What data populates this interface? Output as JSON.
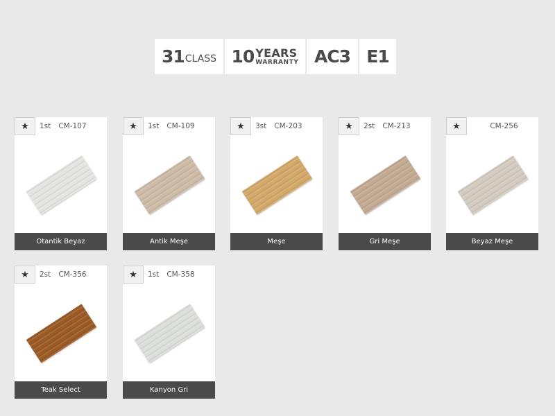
{
  "badges": [
    {
      "big": "31",
      "small": "CLASS"
    },
    {
      "big": "10",
      "l1": "YEARS",
      "l2": "WARRANTY"
    },
    {
      "big": "AC3"
    },
    {
      "big": "E1"
    }
  ],
  "icons": {
    "favorite": "star-icon"
  },
  "products": [
    {
      "rank": "1st",
      "code": "CM-107",
      "name": "Otantik Beyaz",
      "color": "#e4e4e2"
    },
    {
      "rank": "1st",
      "code": "CM-109",
      "name": "Antik Meşe",
      "color": "#cdbba7"
    },
    {
      "rank": "3st",
      "code": "CM-203",
      "name": "Meşe",
      "color": "#d3a868"
    },
    {
      "rank": "2st",
      "code": "CM-213",
      "name": "Gri Meşe",
      "color": "#c2aa92"
    },
    {
      "rank": "",
      "code": "CM-256",
      "name": "Beyaz Meşe",
      "color": "#d4cbc0"
    },
    {
      "rank": "2st",
      "code": "CM-356",
      "name": "Teak Select",
      "color": "#9b5a24"
    },
    {
      "rank": "1st",
      "code": "CM-358",
      "name": "Kanyon Gri",
      "color": "#dcdedb"
    }
  ]
}
